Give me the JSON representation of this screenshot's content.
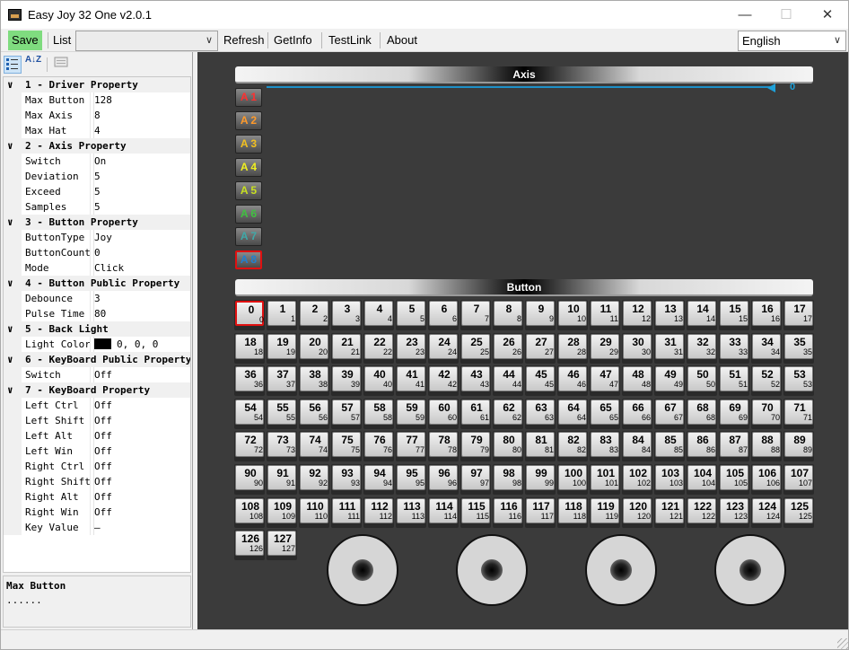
{
  "window": {
    "title": "Easy Joy 32 One v2.0.1",
    "minimize": "—",
    "maximize": "☐",
    "close": "✕"
  },
  "toolbar": {
    "save": "Save",
    "list": "List",
    "list_value": "",
    "refresh": "Refresh",
    "getinfo": "GetInfo",
    "testlink": "TestLink",
    "about": "About",
    "language": "English",
    "save_color": "#7fdc7f"
  },
  "propgrid": {
    "sort_categorized_icon": "categorized-icon",
    "sort_alpha_label": "A↓Z",
    "pages_icon": "property-pages-icon",
    "rows": [
      {
        "type": "cat",
        "chev": "∨",
        "text": "1 - Driver Property"
      },
      {
        "type": "prop",
        "name": "Max Button",
        "value": "128"
      },
      {
        "type": "prop",
        "name": "Max Axis",
        "value": "8"
      },
      {
        "type": "prop",
        "name": "Max Hat",
        "value": "4"
      },
      {
        "type": "cat",
        "chev": "∨",
        "text": "2 - Axis Property"
      },
      {
        "type": "prop",
        "name": "Switch",
        "value": "On"
      },
      {
        "type": "prop",
        "name": "Deviation",
        "value": "5"
      },
      {
        "type": "prop",
        "name": "Exceed",
        "value": "5"
      },
      {
        "type": "prop",
        "name": "Samples",
        "value": "5"
      },
      {
        "type": "cat",
        "chev": "∨",
        "text": "3 - Button Property"
      },
      {
        "type": "prop",
        "name": "ButtonType",
        "value": "Joy"
      },
      {
        "type": "prop",
        "name": "ButtonCount",
        "value": "0"
      },
      {
        "type": "prop",
        "name": "Mode",
        "value": "Click"
      },
      {
        "type": "cat",
        "chev": "∨",
        "text": "4 - Button Public Property"
      },
      {
        "type": "prop",
        "name": "Debounce",
        "value": "3"
      },
      {
        "type": "prop",
        "name": "Pulse Time",
        "value": "80"
      },
      {
        "type": "cat",
        "chev": "∨",
        "text": "5 - Back Light"
      },
      {
        "type": "prop",
        "name": "Light Color",
        "value": "0, 0, 0",
        "swatch": "#000000"
      },
      {
        "type": "cat",
        "chev": "∨",
        "text": "6 - KeyBoard Public Property"
      },
      {
        "type": "prop",
        "name": "Switch",
        "value": "Off"
      },
      {
        "type": "cat",
        "chev": "∨",
        "text": "7 - KeyBoard Property"
      },
      {
        "type": "prop",
        "name": "Left Ctrl",
        "value": "Off"
      },
      {
        "type": "prop",
        "name": "Left Shift",
        "value": "Off"
      },
      {
        "type": "prop",
        "name": "Left Alt",
        "value": "Off"
      },
      {
        "type": "prop",
        "name": "Left Win",
        "value": "Off"
      },
      {
        "type": "prop",
        "name": "Right Ctrl",
        "value": "Off"
      },
      {
        "type": "prop",
        "name": "Right Shift",
        "value": "Off"
      },
      {
        "type": "prop",
        "name": "Right Alt",
        "value": "Off"
      },
      {
        "type": "prop",
        "name": "Right Win",
        "value": "Off"
      },
      {
        "type": "prop",
        "name": "Key Value",
        "value": "—"
      }
    ],
    "desc_title": "Max Button",
    "desc_text": "......"
  },
  "axis": {
    "header": "Axis",
    "value": "0",
    "track_color": "#1e90c8",
    "buttons": [
      {
        "label": "A 1",
        "color": "#ff3030"
      },
      {
        "label": "A 2",
        "color": "#ff9a2a"
      },
      {
        "label": "A 3",
        "color": "#f2c020"
      },
      {
        "label": "A 4",
        "color": "#f0f020"
      },
      {
        "label": "A 5",
        "color": "#c8e020"
      },
      {
        "label": "A 6",
        "color": "#40c040"
      },
      {
        "label": "A 7",
        "color": "#40a8a8"
      },
      {
        "label": "A 8",
        "color": "#2080d0"
      }
    ],
    "selected": 7
  },
  "buttons": {
    "header": "Button",
    "count": 128,
    "selected": 0
  },
  "hats": {
    "count": 4
  }
}
